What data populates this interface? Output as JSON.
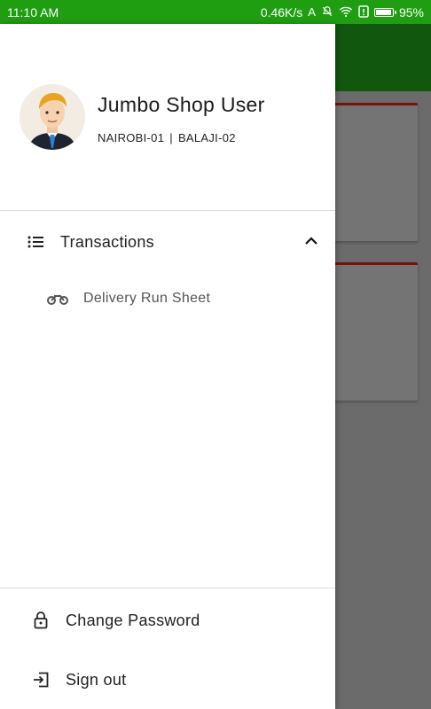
{
  "status_bar": {
    "time": "11:10 AM",
    "network_speed": "0.46K/s",
    "battery_percent": "95%",
    "battery_level": 0.95,
    "icons": [
      "a-icon",
      "mute-bell-icon",
      "wifi-icon",
      "alert-sim-icon",
      "battery-icon"
    ]
  },
  "drawer": {
    "user": {
      "name": "Jumbo Shop User",
      "store_primary": "NAIROBI-01",
      "separator": "|",
      "store_secondary": "BALAJI-02",
      "avatar_icon": "user-avatar-icon"
    },
    "menu": {
      "transactions_label": "Transactions",
      "transactions_icon": "list-icon",
      "transactions_expanded_icon": "chevron-up-icon",
      "delivery_label": "Delivery Run Sheet",
      "delivery_icon": "motorbike-icon"
    },
    "footer": {
      "change_password_label": "Change Password",
      "change_password_icon": "lock-icon",
      "sign_out_label": "Sign out",
      "sign_out_icon": "sign-out-icon"
    }
  },
  "colors": {
    "status_bar": "#1f9e12",
    "toolbar_dimmed": "#11570e",
    "scrim": "#6b6b6b",
    "card_accent": "#7a1010"
  }
}
